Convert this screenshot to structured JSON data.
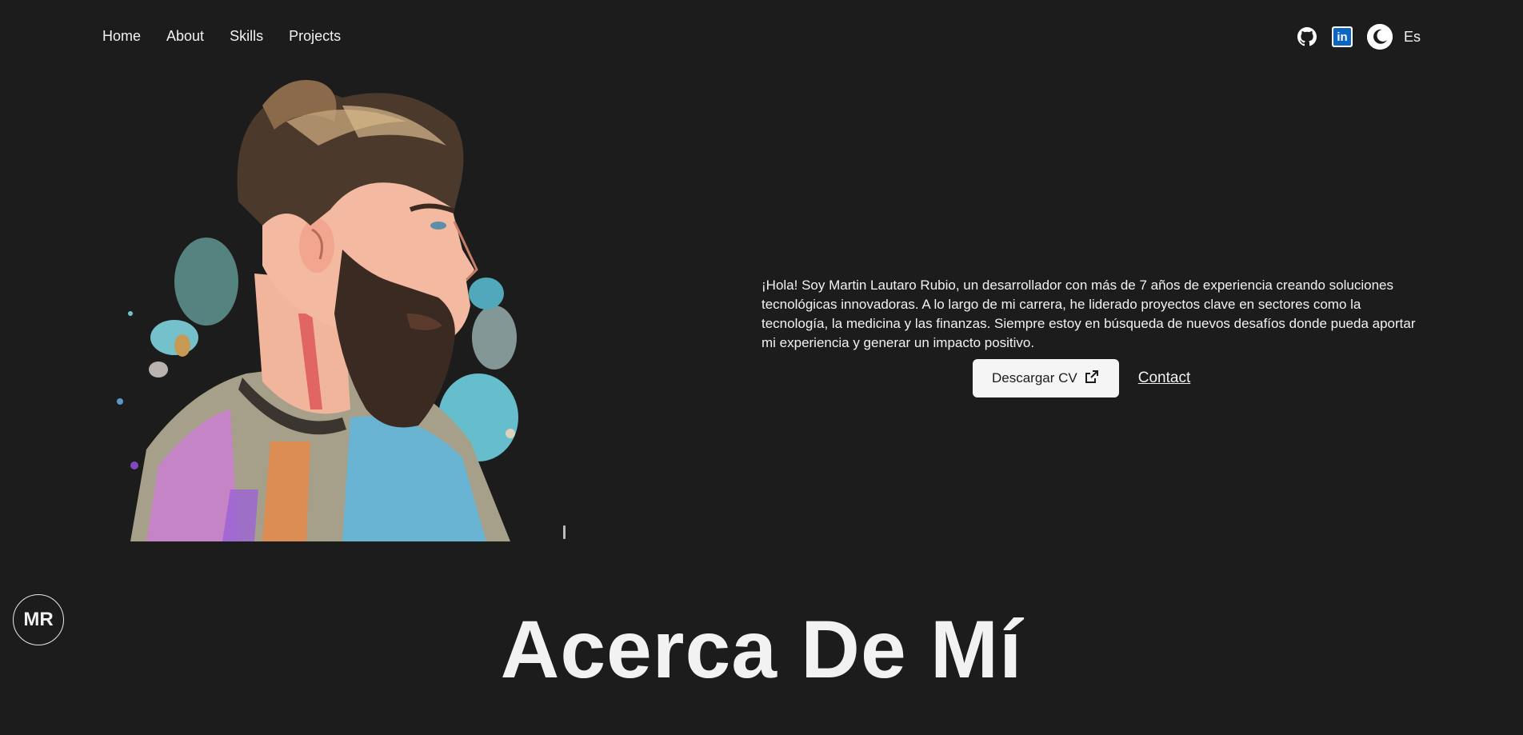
{
  "nav": {
    "links": [
      "Home",
      "About",
      "Skills",
      "Projects"
    ],
    "language": "Es"
  },
  "icons": {
    "github": "github-icon",
    "linkedin": "linkedin-icon",
    "linkedin_glyph": "in",
    "theme": "moon-icon",
    "external": "external-link-icon"
  },
  "hero": {
    "bio": "¡Hola! Soy Martin Lautaro Rubio, un desarrollador con más de 7 años de experiencia creando soluciones tecnológicas innovadoras. A lo largo de mi carrera, he liderado proyectos clave en sectores como la tecnología, la medicina y las finanzas. Siempre estoy en búsqueda de nuevos desafíos donde pueda aportar mi experiencia y generar un impacto positivo.",
    "cv_button": "Descargar CV",
    "contact_link": "Contact"
  },
  "logo": {
    "initials": "MR"
  },
  "about": {
    "title": "Acerca De Mí"
  },
  "colors": {
    "background": "#1c1c1c",
    "text": "#f2f2f2",
    "linkedin": "#0a66c2"
  }
}
